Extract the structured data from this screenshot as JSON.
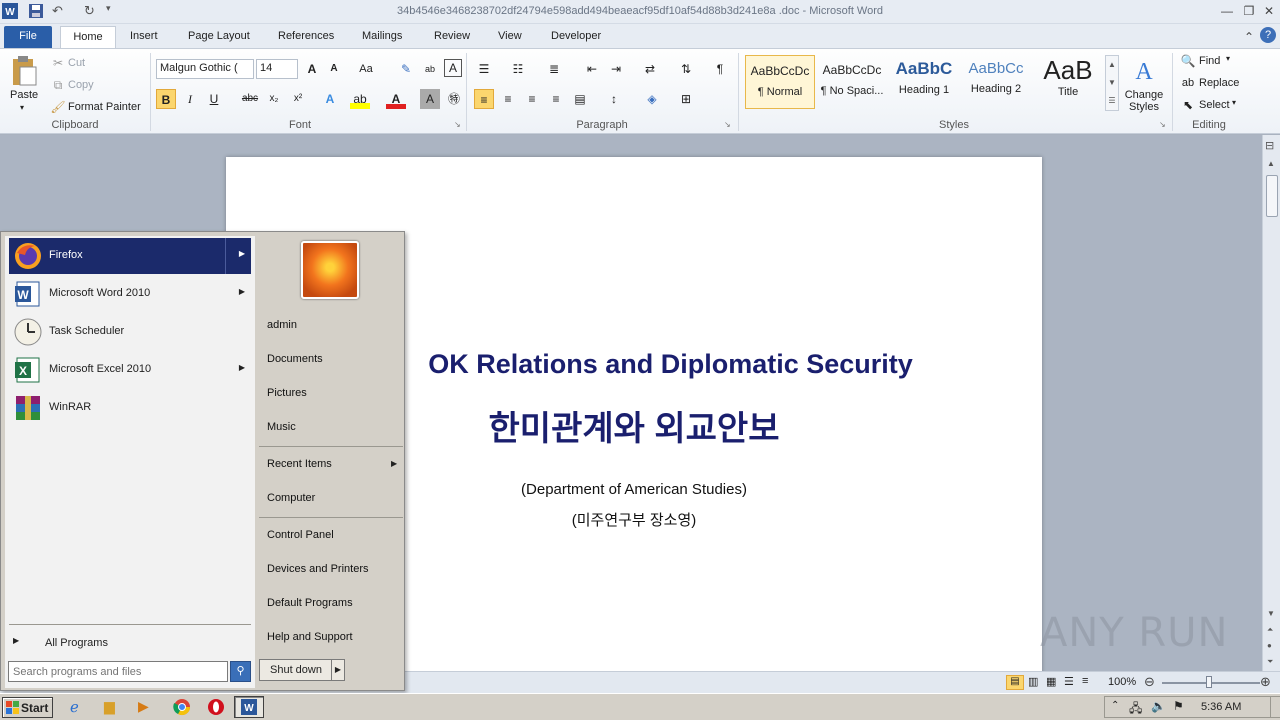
{
  "window": {
    "title": "34b4546e3468238702df24794e598add494beaeacf95df10af54d88b3d241e8a .doc - Microsoft Word"
  },
  "ribbon_tabs": [
    "File",
    "Home",
    "Insert",
    "Page Layout",
    "References",
    "Mailings",
    "Review",
    "View",
    "Developer"
  ],
  "clipboard": {
    "paste": "Paste",
    "cut": "Cut",
    "copy": "Copy",
    "format_painter": "Format Painter",
    "label": "Clipboard"
  },
  "font": {
    "name": "Malgun Gothic (",
    "size": "14",
    "label": "Font",
    "bold": "B",
    "italic": "I",
    "underline": "U"
  },
  "paragraph": {
    "label": "Paragraph"
  },
  "styles": {
    "label": "Styles",
    "items": [
      {
        "sample": "AaBbCcDc",
        "name": "¶ Normal"
      },
      {
        "sample": "AaBbCcDc",
        "name": "¶ No Spaci..."
      },
      {
        "sample": "AaBbC",
        "name": "Heading 1"
      },
      {
        "sample": "AaBbCc",
        "name": "Heading 2"
      },
      {
        "sample": "AaB",
        "name": "Title"
      }
    ],
    "change_styles": "Change Styles"
  },
  "editing": {
    "label": "Editing",
    "find": "Find",
    "replace": "Replace",
    "select": "Select"
  },
  "document": {
    "title_en": "OK Relations and Diplomatic Security",
    "title_ko": "한미관계와 외교안보",
    "dept_en": "(Department of American Studies)",
    "dept_ko": "(미주연구부 장소영)"
  },
  "statusbar": {
    "zoom": "100%"
  },
  "start_menu": {
    "programs": [
      {
        "label": "Firefox",
        "has_submenu": true,
        "highlighted": true
      },
      {
        "label": "Microsoft Word 2010",
        "has_submenu": true
      },
      {
        "label": "Task Scheduler",
        "has_submenu": false
      },
      {
        "label": "Microsoft Excel 2010",
        "has_submenu": true
      },
      {
        "label": "WinRAR",
        "has_submenu": false
      }
    ],
    "all_programs": "All Programs",
    "search_placeholder": "Search programs and files",
    "right_items": {
      "admin": "admin",
      "documents": "Documents",
      "pictures": "Pictures",
      "music": "Music",
      "recent_items": "Recent Items",
      "computer": "Computer",
      "control_panel": "Control Panel",
      "devices_printers": "Devices and Printers",
      "default_programs": "Default Programs",
      "help_support": "Help and Support"
    },
    "shutdown": "Shut down"
  },
  "taskbar": {
    "start": "Start",
    "clock": "5:36 AM"
  },
  "watermark": "ANY RUN"
}
